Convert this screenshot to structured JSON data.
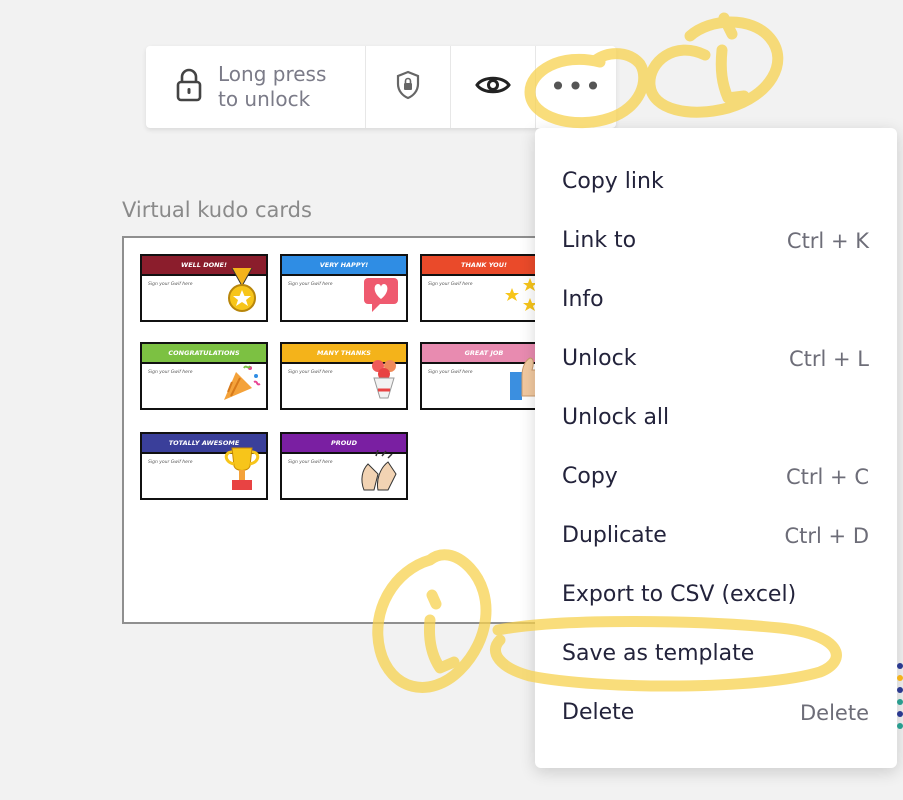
{
  "toolbar": {
    "lock_label_line1": "Long press",
    "lock_label_line2": "to unlock",
    "more_label": "•••"
  },
  "frame": {
    "title": "Virtual kudo cards",
    "cards": [
      {
        "title": "WELL DONE!",
        "color": "#8b1d2c",
        "art": "medal-icon",
        "sign": "Sign your Gwif here"
      },
      {
        "title": "VERY HAPPY!",
        "color": "#2f8de4",
        "art": "heart-chat-icon",
        "sign": "Sign your Gwif here"
      },
      {
        "title": "THANK YOU!",
        "color": "#ea4a2a",
        "art": "stars-icon",
        "sign": "Sign your Gwif here"
      },
      {
        "title": "CONGRATULATIONS",
        "color": "#7cc142",
        "art": "party-popper-icon",
        "sign": "Sign your Gwif here"
      },
      {
        "title": "MANY THANKS",
        "color": "#f4b31a",
        "art": "bouquet-icon",
        "sign": "Sign your Gwif here"
      },
      {
        "title": "GREAT JOB",
        "color": "#e88bb0",
        "art": "thumbs-up-icon",
        "sign": "Sign your Gwif here"
      },
      {
        "title": "TOTALLY AWESOME",
        "color": "#3a3f9a",
        "art": "trophy-icon",
        "sign": "Sign your Gwif here"
      },
      {
        "title": "PROUD",
        "color": "#7a1fa2",
        "art": "clapping-hands-icon",
        "sign": "Sign your Gwif here"
      }
    ]
  },
  "menu": {
    "items": [
      {
        "label": "Copy link",
        "shortcut": ""
      },
      {
        "label": "Link to",
        "shortcut": "Ctrl + K"
      },
      {
        "label": "Info",
        "shortcut": ""
      },
      {
        "label": "Unlock",
        "shortcut": "Ctrl + L"
      },
      {
        "label": "Unlock all",
        "shortcut": ""
      },
      {
        "label": "Copy",
        "shortcut": "Ctrl + C"
      },
      {
        "label": "Duplicate",
        "shortcut": "Ctrl + D"
      },
      {
        "label": "Export to CSV (excel)",
        "shortcut": ""
      },
      {
        "label": "Save as template",
        "shortcut": ""
      },
      {
        "label": "Delete",
        "shortcut": "Delete"
      }
    ]
  },
  "colors": {
    "highlighter": "#f7d24f",
    "menu_text": "#23233b",
    "shortcut_text": "#6d6d78"
  }
}
